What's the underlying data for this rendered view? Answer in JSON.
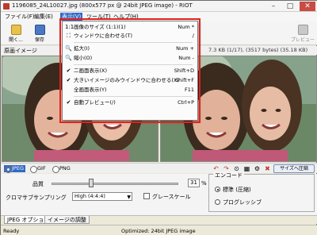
{
  "window": {
    "title": "1196085_24L10027.jpg (800x577 px @ 24bit JPEG image) - RIOT",
    "min_icon": "–",
    "max_icon": "□",
    "close_icon": "✕"
  },
  "menubar": {
    "items": [
      "ファイル(F)",
      "編集(E)",
      "表示(V)",
      "ツール(T)",
      "ヘルプ(H)"
    ]
  },
  "toolbar": {
    "open_label": "開く...",
    "save_label": "保存",
    "preview_label": "プレビュー"
  },
  "preview": {
    "title": "原画イメージ",
    "file_info": "7.3 KB (1/17), (3517 bytes) (35.18 KB)"
  },
  "view_menu": {
    "items": [
      {
        "icon": "1:1",
        "label": "画像のサイズ (1:1)(1)",
        "shortcut": "Num *"
      },
      {
        "icon": "⛶",
        "label": "ウィンドウに合わせる(T)",
        "shortcut": "/"
      },
      {
        "icon": "🔍",
        "label": "拡大(I)",
        "shortcut": "Num +"
      },
      {
        "icon": "🔍",
        "label": "縮小(O)",
        "shortcut": "Num -"
      },
      {
        "icon": "✔",
        "label": "二画面表示(X)",
        "shortcut": "Shift+D"
      },
      {
        "icon": "✔",
        "label": "大きいイメージのみウインドウに合わせる(X)",
        "shortcut": "Shift+F"
      },
      {
        "icon": "",
        "label": "全画面表示(Y)",
        "shortcut": "F11"
      },
      {
        "icon": "✔",
        "label": "自動プレビュー(/)",
        "shortcut": "Ctrl+P"
      }
    ]
  },
  "format_bar": {
    "formats": [
      "JPEG",
      "GIF",
      "PNG"
    ],
    "selected": "JPEG",
    "optimize_button": "サイズへ圧縮"
  },
  "settings": {
    "quality_label": "品質",
    "quality_value": "31",
    "quality_percent": "%",
    "quality_fraction": 0.31,
    "chroma_label": "クロマサブサンプリング",
    "chroma_value": "High (4:4:4)",
    "grayscale_label": "グレースケール",
    "options_legend": "エンコード",
    "radio_standard": "標準 (圧縮)",
    "radio_progressive": "プログレッシブ"
  },
  "tabs": [
    "JPEG オプション",
    "イメージの調整"
  ],
  "status": {
    "left": "Ready",
    "middle": "Optimized: 24bit JPEG image"
  },
  "colors": {
    "highlight_border": "#e0231d",
    "menu_active": "#3169c6"
  }
}
